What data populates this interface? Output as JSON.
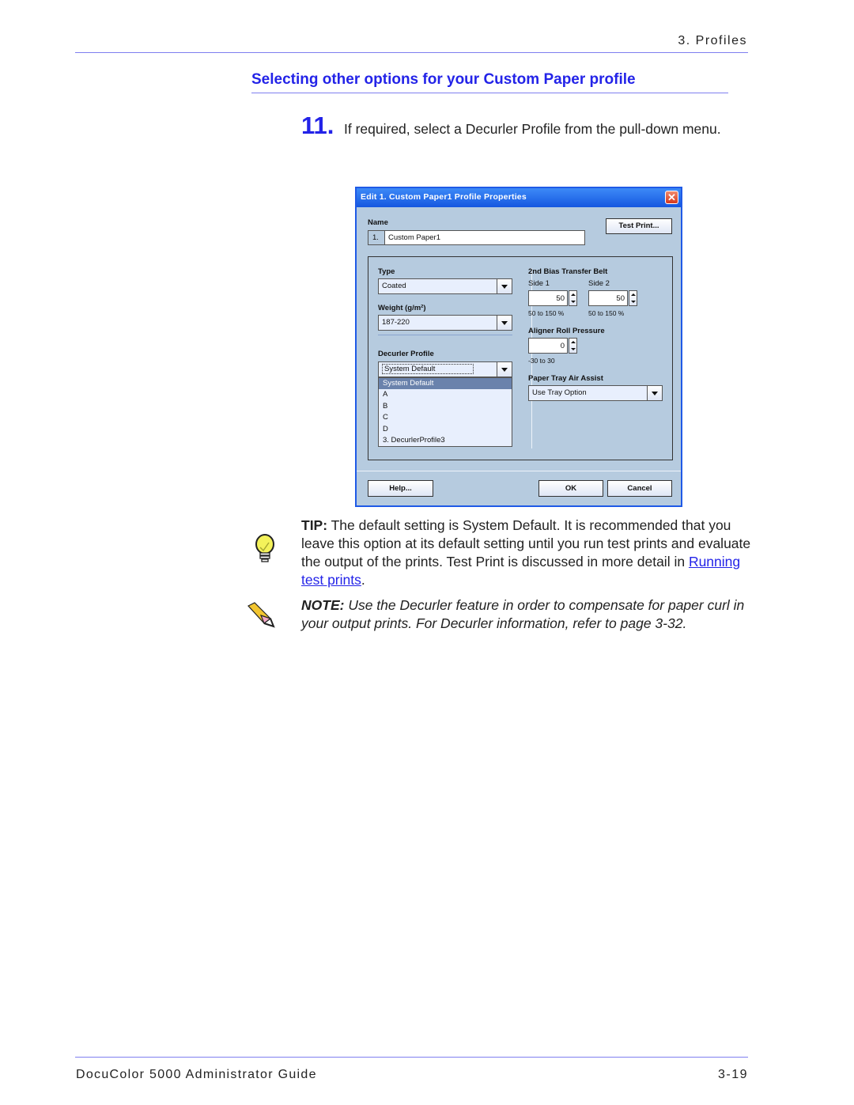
{
  "header": {
    "section": "3. Profiles"
  },
  "title": "Selecting other options for your Custom Paper profile",
  "step": {
    "number": "11.",
    "text": "If required, select a Decurler Profile from the pull-down menu."
  },
  "dialog": {
    "title": "Edit 1. Custom Paper1 Profile Properties",
    "close_symbol": "✕",
    "name_label": "Name",
    "name_index": "1.",
    "name_value": "Custom Paper1",
    "test_print_label": "Test Print...",
    "type_label": "Type",
    "type_value": "Coated",
    "weight_label": "Weight (g/m²)",
    "weight_value": "187-220",
    "decurler_label": "Decurler Profile",
    "decurler_value": "System Default",
    "decurler_options": [
      "System Default",
      "A",
      "B",
      "C",
      "D",
      "3. DecurlerProfile3"
    ],
    "bias_label": "2nd Bias Transfer Belt",
    "side1_label": "Side 1",
    "side1_value": "50",
    "side1_range": "50 to 150 %",
    "side2_label": "Side 2",
    "side2_value": "50",
    "side2_range": "50 to 150 %",
    "aligner_label": "Aligner Roll Pressure",
    "aligner_value": "0",
    "aligner_range": "-30 to 30",
    "air_assist_label": "Paper Tray Air Assist",
    "air_assist_value": "Use Tray Option",
    "help_label": "Help...",
    "ok_label": "OK",
    "cancel_label": "Cancel"
  },
  "tip": {
    "icon": "lightbulb-icon",
    "label": "TIP:",
    "text_before_link": " The default setting is System Default.  It is recommended that you leave this option at its default setting until you run test prints and evaluate the output of the prints.  Test Print is discussed in more detail in ",
    "link_text": "Running test prints",
    "text_after_link": "."
  },
  "note": {
    "icon": "pencil-icon",
    "label": "NOTE:",
    "text": " Use the Decurler feature in order to compensate for paper curl in your output prints.  For Decurler information, refer to page 3-32."
  },
  "footer": {
    "guide_title": "DocuColor 5000 Administrator Guide",
    "page_number": "3-19"
  },
  "colors": {
    "accent": "#2323e8",
    "rule": "#7f7ff0",
    "dialog_bg": "#b6cbdf",
    "titlebar": "#1f5ae6"
  }
}
